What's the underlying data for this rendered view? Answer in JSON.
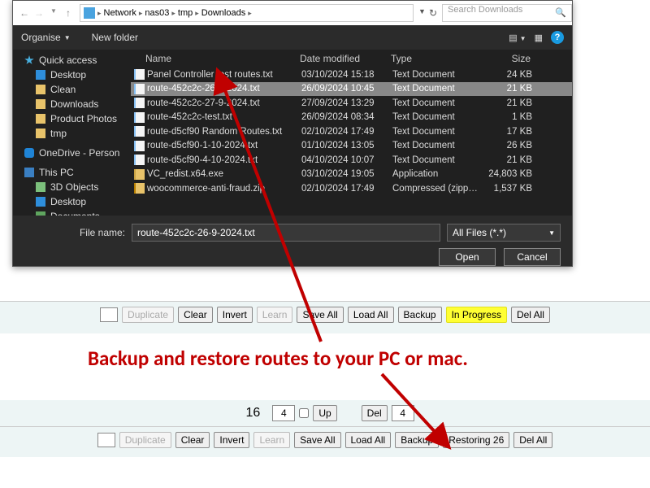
{
  "dialog": {
    "breadcrumb": [
      "Network",
      "nas03",
      "tmp",
      "Downloads"
    ],
    "search_placeholder": "Search Downloads",
    "toolbar": {
      "organise": "Organise",
      "new_folder": "New folder"
    },
    "columns": {
      "name": "Name",
      "date": "Date modified",
      "type": "Type",
      "size": "Size"
    },
    "sidebar": {
      "quick": "Quick access",
      "items": [
        "Desktop",
        "Clean",
        "Downloads",
        "Product Photos",
        "tmp"
      ],
      "onedrive": "OneDrive - Person",
      "thispc": "This PC",
      "pcitems": [
        "3D Objects",
        "Desktop",
        "Documents"
      ]
    },
    "files": [
      {
        "name": "Panel Controller test routes.txt",
        "date": "03/10/2024 15:18",
        "type": "Text Document",
        "size": "24 KB",
        "icon": "txt"
      },
      {
        "name": "route-452c2c-26-9-2024.txt",
        "date": "26/09/2024 10:45",
        "type": "Text Document",
        "size": "21 KB",
        "icon": "txt",
        "selected": true
      },
      {
        "name": "route-452c2c-27-9-2024.txt",
        "date": "27/09/2024 13:29",
        "type": "Text Document",
        "size": "21 KB",
        "icon": "txt"
      },
      {
        "name": "route-452c2c-test.txt",
        "date": "26/09/2024 08:34",
        "type": "Text Document",
        "size": "1 KB",
        "icon": "txt"
      },
      {
        "name": "route-d5cf90 Random Routes.txt",
        "date": "02/10/2024 17:49",
        "type": "Text Document",
        "size": "17 KB",
        "icon": "txt"
      },
      {
        "name": "route-d5cf90-1-10-2024.txt",
        "date": "01/10/2024 13:05",
        "type": "Text Document",
        "size": "26 KB",
        "icon": "txt"
      },
      {
        "name": "route-d5cf90-4-10-2024.txt",
        "date": "04/10/2024 10:07",
        "type": "Text Document",
        "size": "21 KB",
        "icon": "txt"
      },
      {
        "name": "VC_redist.x64.exe",
        "date": "03/10/2024 19:05",
        "type": "Application",
        "size": "24,803 KB",
        "icon": "exe"
      },
      {
        "name": "woocommerce-anti-fraud.zip",
        "date": "02/10/2024 17:49",
        "type": "Compressed (zipp…",
        "size": "1,537 KB",
        "icon": "zip"
      }
    ],
    "file_name_label": "File name:",
    "file_name_value": "route-452c2c-26-9-2024.txt",
    "filter": "All Files (*.*)",
    "open": "Open",
    "cancel": "Cancel"
  },
  "panel1": {
    "duplicate": "Duplicate",
    "clear": "Clear",
    "invert": "Invert",
    "learn": "Learn",
    "save_all": "Save All",
    "load_all": "Load All",
    "backup": "Backup",
    "status": "In Progress",
    "del_all": "Del All"
  },
  "panel2": {
    "row_num": "16",
    "val_left": "4",
    "up": "Up",
    "del": "Del",
    "val_right": "4",
    "duplicate": "Duplicate",
    "clear": "Clear",
    "invert": "Invert",
    "learn": "Learn",
    "save_all": "Save All",
    "load_all": "Load All",
    "backup": "Backup",
    "status": "Restoring 26",
    "del_all": "Del All"
  },
  "annotation": "Backup and restore routes to your PC or mac."
}
